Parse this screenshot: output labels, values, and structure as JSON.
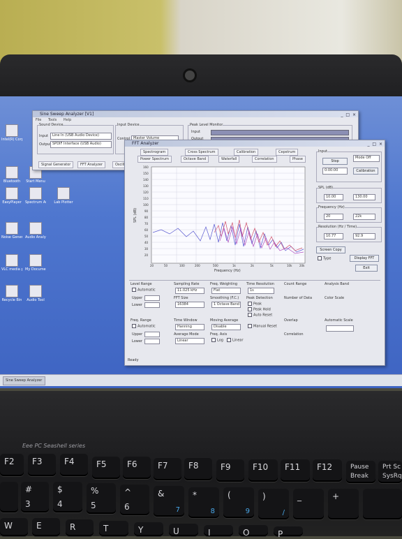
{
  "desktop_icons": [
    {
      "label": "Intel(R) Corporation Graphics"
    },
    {
      "label": "Bluetooth"
    },
    {
      "label": "Start Menu"
    },
    {
      "label": "EasyPlayer"
    },
    {
      "label": "Spectrum Analyzer"
    },
    {
      "label": "Lab Plotter"
    },
    {
      "label": "Noise Generator"
    },
    {
      "label": "Audio Analyzer"
    },
    {
      "label": "VLC media player"
    },
    {
      "label": "My Documents"
    },
    {
      "label": "Recycle Bin"
    },
    {
      "label": "Audio Tool"
    }
  ],
  "main_window": {
    "title": "Sine Sweep Analyzer [V1]",
    "menu": [
      "File",
      "Tools",
      "Help"
    ],
    "sound_device_label": "Sound Device",
    "input_label": "Input",
    "output_label": "Output",
    "input_value": "Line In (USB Audio Device)",
    "output_value": "SPDIF Interface (USB Audio)",
    "input_device_label": "Input Device",
    "control_label": "Control",
    "control_value": "Master Volume",
    "peak_label": "Peak Level Monitor",
    "peak_input": "Input",
    "peak_output": "Output",
    "tab_signal": "Signal Generator",
    "tab_fft": "FFT Analyzer",
    "tab_other": "Oscill"
  },
  "fft_window": {
    "title": "FFT Analyzer",
    "tabs_top": [
      "Spectrogram",
      "Cross Spectrum",
      "Calibration",
      "Cepstrum"
    ],
    "tabs_bottom": [
      "Power Spectrum",
      "Octave Band",
      "Waterfall",
      "Correlation",
      "Phase"
    ],
    "y_label": "SPL (dB)",
    "x_label": "Frequency (Hz)",
    "y_ticks": [
      "160",
      "150",
      "140",
      "130",
      "120",
      "110",
      "100",
      "90",
      "80",
      "70",
      "60",
      "50",
      "40",
      "30",
      "20"
    ],
    "x_ticks": [
      "20",
      "50",
      "100",
      "200",
      "500",
      "1k",
      "2k",
      "5k",
      "10k",
      "20k"
    ],
    "input_box": "Input",
    "input_btn": "Stop",
    "input_time": "0:00:00",
    "mode_right": "Mode Off",
    "calibration_btn": "Calibration",
    "spl_label": "SPL (dB)",
    "spl_min": "10.00",
    "spl_max": "130.00",
    "freq_label": "Frequency (Hz)",
    "freq_min": "20",
    "freq_max": "22k",
    "resolution_label": "Resolution (Hz / Time)",
    "res_value": "10.77",
    "res_time": "92.9",
    "scale_label": "Screen Copy",
    "type_label": "Type",
    "display_btn": "Display FFT",
    "exit_btn": "Exit",
    "level_range": "Level Range",
    "automatic": "Automatic",
    "upper": "Upper",
    "lower": "Lower",
    "sampling_rate": "Sampling Rate",
    "sampling_value": "11.025 kHz",
    "fft_size": "FFT Size",
    "fft_size_value": "16384",
    "freq_weighting": "Freq. Weighting",
    "freq_weighting_value": "Flat",
    "smoothing": "Smoothing (F.C.)",
    "smoothing_value": "1 Octave Band",
    "time_resolution": "Time Resolution",
    "time_res_value": "1s",
    "peak_detection": "Peak Detection",
    "peak": "Peak",
    "peak_hold": "Peak Hold",
    "auto_reset": "Auto Reset",
    "count_range": "Count Range",
    "number_of_data": "Number of Data",
    "analysis_band": "Analysis Band",
    "color_scale": "Color Scale",
    "freq_range": "Freq. Range",
    "time_window": "Time Window",
    "time_window_value": "Hanning",
    "moving_average": "Moving Average",
    "moving_avg_value": "Disable",
    "average_mode": "Average Mode",
    "average_mode_value": "Linear",
    "freq_axis": "Freq. Axis",
    "log": "Log",
    "linear": "Linear",
    "manual_reset": "Manual Reset",
    "overlap": "Overlap",
    "correlation": "Correlation",
    "automatic_scale": "Automatic Scale",
    "status": "Ready"
  },
  "taskbar": {
    "item": "Sine Sweep Analyzer"
  },
  "keyboard": {
    "brand": "Eee PC Seashell series",
    "fn_keys": [
      "F2",
      "F3",
      "F4",
      "F5",
      "F6",
      "F7",
      "F8",
      "F9",
      "F10",
      "F11",
      "F12"
    ],
    "pause": "Pause",
    "pause_sub": "Break",
    "prtsc": "Prt Sc",
    "prtsc_sub": "SysRq",
    "num_top": [
      "#",
      "$",
      "%",
      "^",
      "&",
      "*",
      "(",
      ")",
      "_",
      "+"
    ],
    "num_bottom": [
      "3",
      "4",
      "5",
      "6",
      "7",
      "8",
      "9",
      "0",
      "-",
      "="
    ],
    "num_sub": [
      "",
      "",
      "",
      "",
      "7",
      "8",
      "9",
      "/",
      "",
      ""
    ],
    "letters": [
      "W",
      "E",
      "R",
      "T",
      "Y",
      "U",
      "I",
      "O",
      "P"
    ]
  }
}
